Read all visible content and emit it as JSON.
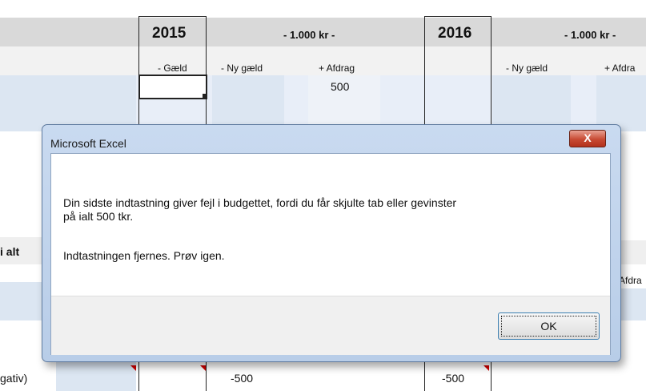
{
  "sheet": {
    "col1": {
      "year": "2015",
      "unit": "- 1.000 kr -",
      "headers": [
        "- Gæld",
        "- Ny gæld",
        "+ Afdrag"
      ],
      "value": "500"
    },
    "col2": {
      "year": "2016",
      "unit": "- 1.000 kr -",
      "headers": [
        "- Ny gæld",
        "+ Afdra"
      ]
    },
    "left_bold_label": "i alt",
    "right_partial_header": "Afdra",
    "bottom_row": {
      "label": "gativ)",
      "values": [
        "-500",
        "-500"
      ]
    },
    "colors": {
      "header_band": "#d9d9d9",
      "input_cell": "#dce6f2",
      "comment_marker": "#d00000"
    }
  },
  "dialog": {
    "title": "Microsoft Excel",
    "close_label": "X",
    "message_line1": "Din sidste indtastning giver fejl i budgettet, fordi du får skjulte tab eller gevinster",
    "message_line2": "på ialt 500 tkr.",
    "message_line3": "Indtastningen fjernes. Prøv igen.",
    "ok_label": "OK"
  }
}
